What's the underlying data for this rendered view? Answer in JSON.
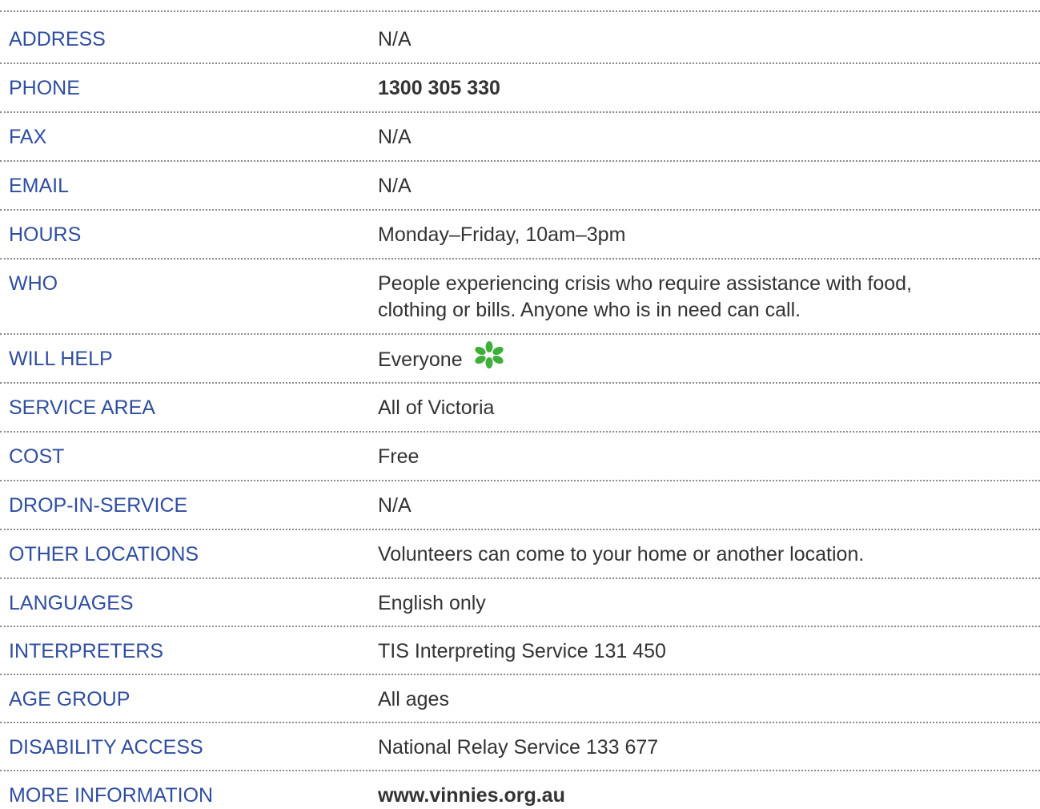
{
  "rows": [
    {
      "label": "ADDRESS",
      "value": "N/A"
    },
    {
      "label": "PHONE",
      "value": "1300 305 330"
    },
    {
      "label": "FAX",
      "value": "N/A"
    },
    {
      "label": "EMAIL",
      "value": "N/A"
    },
    {
      "label": "HOURS",
      "value": "Monday–Friday, 10am–3pm"
    },
    {
      "label": "WHO",
      "value_line1": "People experiencing crisis who require assistance with food,",
      "value_line2": "clothing or bills. Anyone who is in need can call."
    },
    {
      "label": "WILL HELP",
      "value": "Everyone",
      "icon": "green-flower-icon"
    },
    {
      "label": "SERVICE AREA",
      "value": "All of Victoria"
    },
    {
      "label": "COST",
      "value": "Free"
    },
    {
      "label": "DROP-IN-SERVICE",
      "value": "N/A"
    },
    {
      "label": "OTHER LOCATIONS",
      "value": "Volunteers can come to your home or another location."
    },
    {
      "label": "LANGUAGES",
      "value": "English only"
    },
    {
      "label": "INTERPRETERS",
      "value": "TIS Interpreting Service 131 450"
    },
    {
      "label": "AGE GROUP",
      "value": "All ages"
    },
    {
      "label": "DISABILITY ACCESS",
      "value": "National Relay Service 133 677"
    },
    {
      "label": "MORE INFORMATION",
      "value": "www.vinnies.org.au"
    }
  ],
  "colors": {
    "label": "#2f4ea0",
    "value": "#333333",
    "divider": "#8a8a8a",
    "icon": "#3fae3a"
  }
}
